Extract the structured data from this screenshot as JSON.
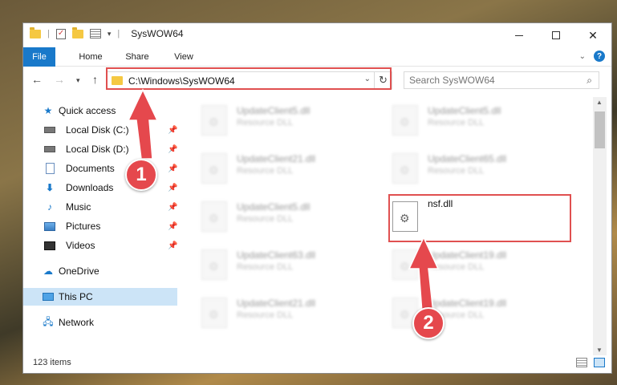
{
  "window": {
    "title": "SysWOW64"
  },
  "ribbon": {
    "tabs": [
      "File",
      "Home",
      "Share",
      "View"
    ]
  },
  "address": {
    "path": "C:\\Windows\\SysWOW64"
  },
  "search": {
    "placeholder": "Search SysWOW64"
  },
  "sidebar": {
    "items": [
      {
        "label": "Quick access",
        "icon": "star-icon"
      },
      {
        "label": "Local Disk (C:)",
        "icon": "drive-icon",
        "pinned": true
      },
      {
        "label": "Local Disk (D:)",
        "icon": "drive-icon",
        "pinned": true
      },
      {
        "label": "Documents",
        "icon": "documents-icon",
        "pinned": true
      },
      {
        "label": "Downloads",
        "icon": "download-icon",
        "pinned": true
      },
      {
        "label": "Music",
        "icon": "music-icon",
        "pinned": true
      },
      {
        "label": "Pictures",
        "icon": "pictures-icon",
        "pinned": true
      },
      {
        "label": "Videos",
        "icon": "videos-icon",
        "pinned": true
      },
      {
        "label": "OneDrive",
        "icon": "cloud-icon"
      },
      {
        "label": "This PC",
        "icon": "pc-icon",
        "selected": true
      },
      {
        "label": "Network",
        "icon": "network-icon"
      }
    ]
  },
  "files": [
    {
      "name": "UpdateClient5.dll",
      "type": "Resource DLL"
    },
    {
      "name": "UpdateClient5.dll",
      "type": "Resource DLL"
    },
    {
      "name": "UpdateClient21.dll",
      "type": "Resource DLL"
    },
    {
      "name": "UpdateClient65.dll",
      "type": "Resource DLL"
    },
    {
      "name": "UpdateClient5.dll",
      "type": "Resource DLL"
    },
    {
      "name": "nsf.dll",
      "type": ""
    },
    {
      "name": "UpdateClient63.dll",
      "type": "Resource DLL"
    },
    {
      "name": "UpdateClient19.dll",
      "type": "Resource DLL"
    },
    {
      "name": "UpdateClient21.dll",
      "type": "Resource DLL"
    },
    {
      "name": "UpdateClient19.dll",
      "type": "Resource DLL"
    }
  ],
  "status": {
    "item_count": "123 items"
  },
  "annotations": {
    "step1": "1",
    "step2": "2",
    "color": "#e5484d"
  }
}
